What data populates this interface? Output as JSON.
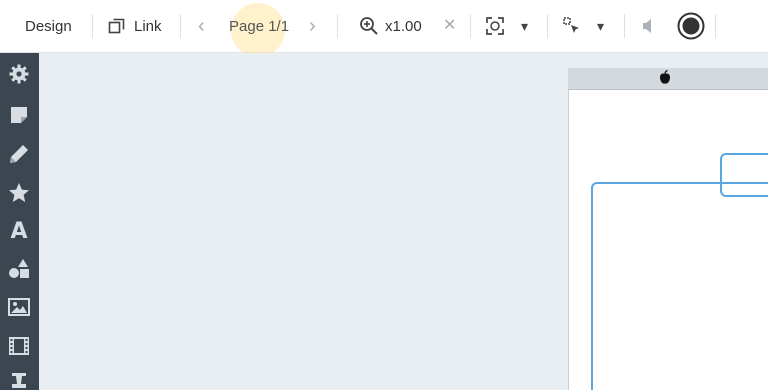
{
  "toolbar": {
    "design_label": "Design",
    "link_label": "Link",
    "page_indicator": "Page 1/1",
    "zoom_label": "x1.00",
    "prev_glyph": "‹",
    "next_glyph": "›",
    "clear_glyph": "✕",
    "dropdown_glyph": "▾"
  },
  "sidebar": {
    "items": [
      {
        "icon": "gear-icon"
      },
      {
        "icon": "sticky-note-icon"
      },
      {
        "icon": "pen-icon"
      },
      {
        "icon": "star-icon"
      },
      {
        "icon": "text-icon",
        "glyph": "A"
      },
      {
        "icon": "shapes-icon"
      },
      {
        "icon": "image-icon"
      },
      {
        "icon": "film-icon"
      },
      {
        "icon": "stamp-icon"
      }
    ]
  },
  "colors": {
    "sidebar_bg": "#3b4651",
    "sidebar_icon": "#d7dde3",
    "workspace_bg": "#e9eef2",
    "frame_border": "#5aa6e0",
    "highlight": "#ffe08c"
  }
}
